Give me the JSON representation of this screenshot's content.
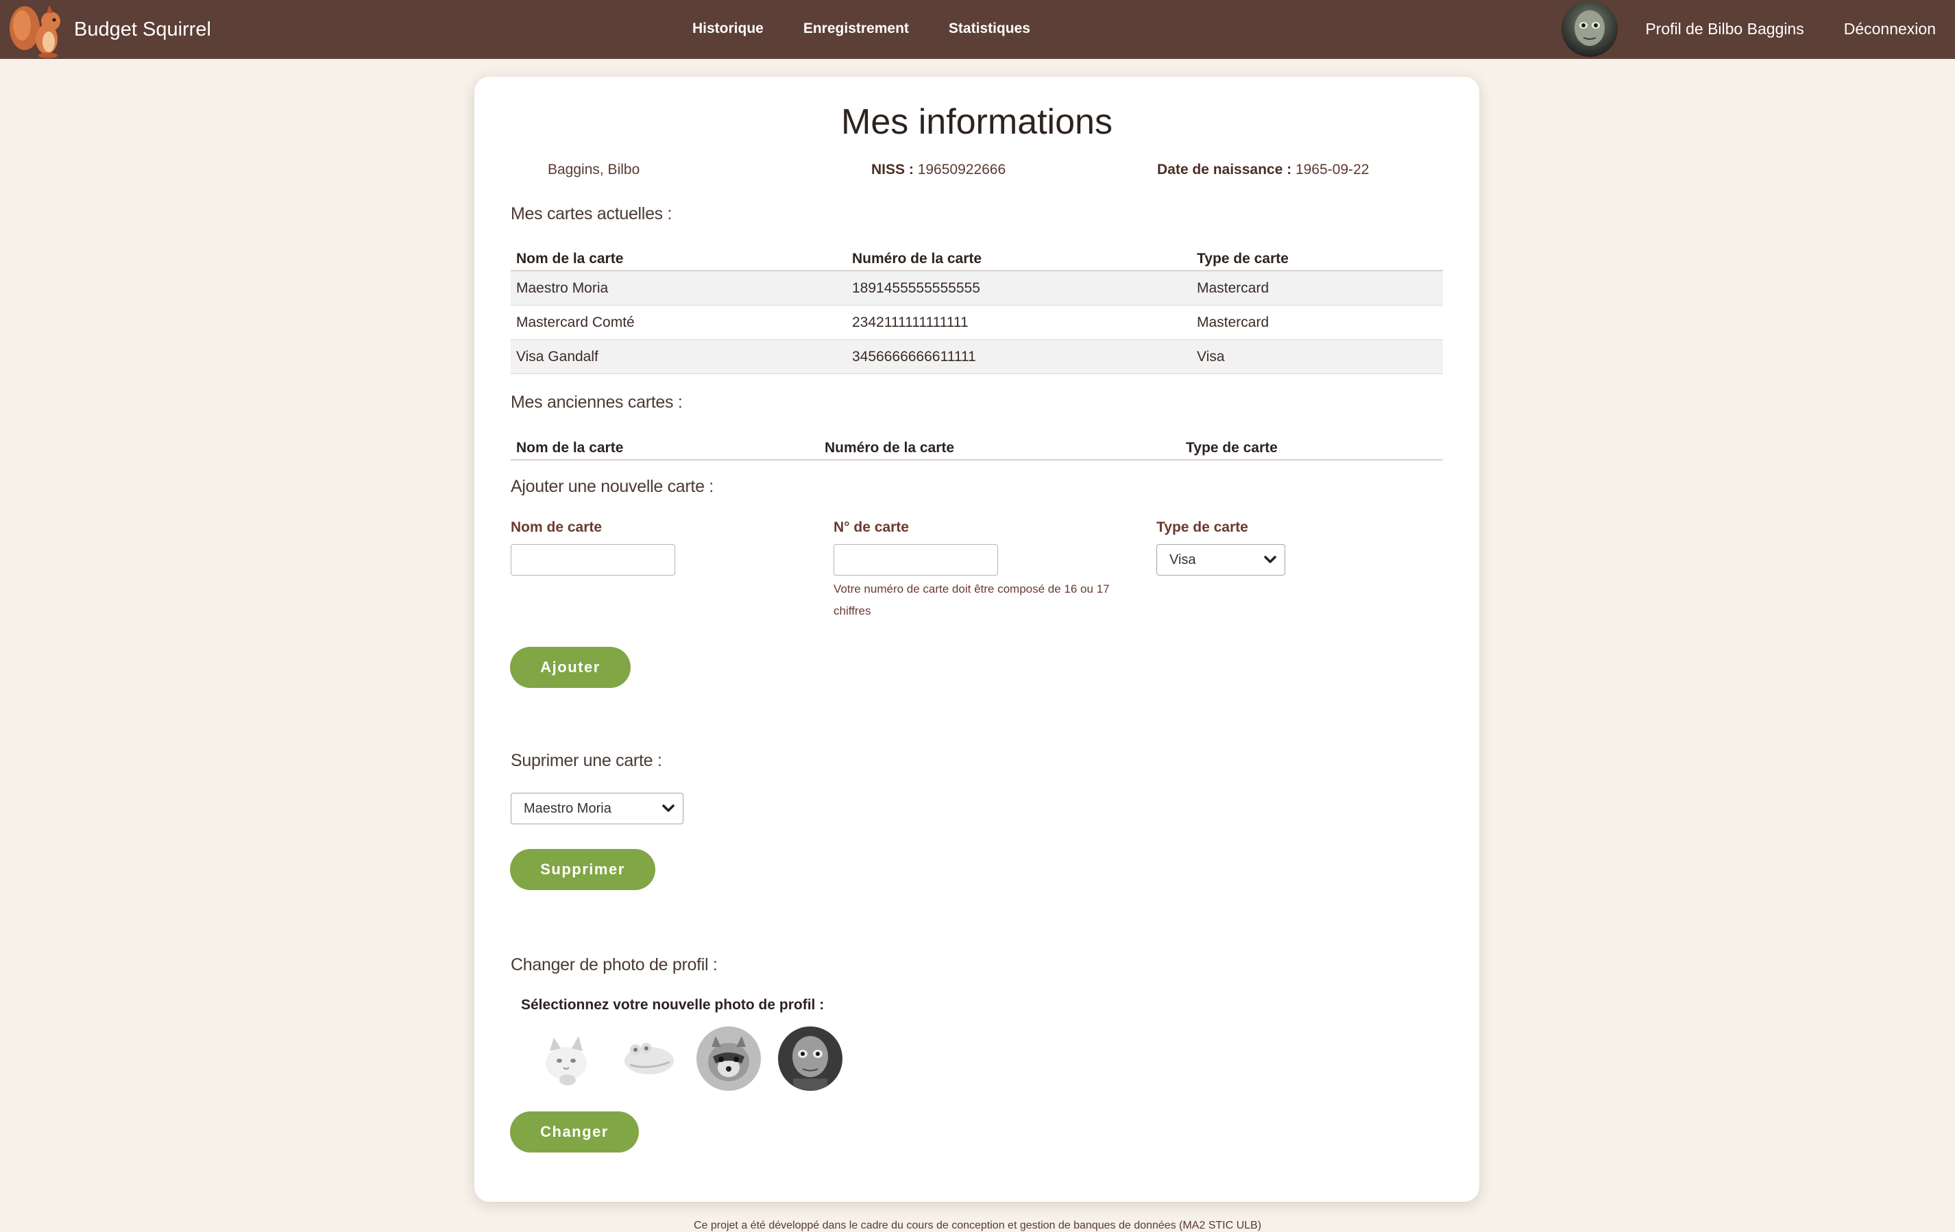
{
  "nav": {
    "brand": "Budget Squirrel",
    "links": [
      "Historique",
      "Enregistrement",
      "Statistiques"
    ],
    "profile_link": "Profil de Bilbo Baggins",
    "logout": "Déconnexion"
  },
  "page": {
    "title": "Mes informations",
    "name": "Baggins, Bilbo",
    "niss_label": "NISS :",
    "niss_value": "19650922666",
    "birth_label": "Date de naissance :",
    "birth_value": "1965-09-22"
  },
  "current_cards": {
    "title": "Mes cartes actuelles :",
    "headers": [
      "Nom de la carte",
      "Numéro de la carte",
      "Type de carte"
    ],
    "rows": [
      [
        "Maestro Moria",
        "1891455555555555",
        "Mastercard"
      ],
      [
        "Mastercard Comté",
        "2342111111111111",
        "Mastercard"
      ],
      [
        "Visa Gandalf",
        "3456666666611111",
        "Visa"
      ]
    ]
  },
  "old_cards": {
    "title": "Mes anciennes cartes :",
    "headers": [
      "Nom de la carte",
      "Numéro de la carte",
      "Type de carte"
    ]
  },
  "add_card": {
    "title": "Ajouter une nouvelle carte :",
    "name_label": "Nom de carte",
    "name_value": "",
    "number_label": "N° de carte",
    "number_value": "",
    "number_hint": "Votre numéro de carte doit être composé de 16 ou 17 chiffres",
    "type_label": "Type de carte",
    "type_selected": "Visa",
    "button": "Ajouter"
  },
  "delete_card": {
    "title": "Suprimer une carte :",
    "selected": "Maestro Moria",
    "button": "Supprimer"
  },
  "change_photo": {
    "title": "Changer de photo de profil :",
    "prompt": "Sélectionnez votre nouvelle photo de profil :",
    "options": [
      "cat-photo",
      "frog-photo",
      "raccoon-photo",
      "gollum-photo"
    ],
    "button": "Changer"
  },
  "footer": {
    "text": "Ce projet a été développé dans le cadre du cours de conception et gestion de banques de données (MA2 STIC ULB)"
  },
  "colors": {
    "navbar": "#5c3f36",
    "accent_button": "#81a645",
    "background": "#f6f1e9",
    "label_brown": "#6b3a2e"
  }
}
